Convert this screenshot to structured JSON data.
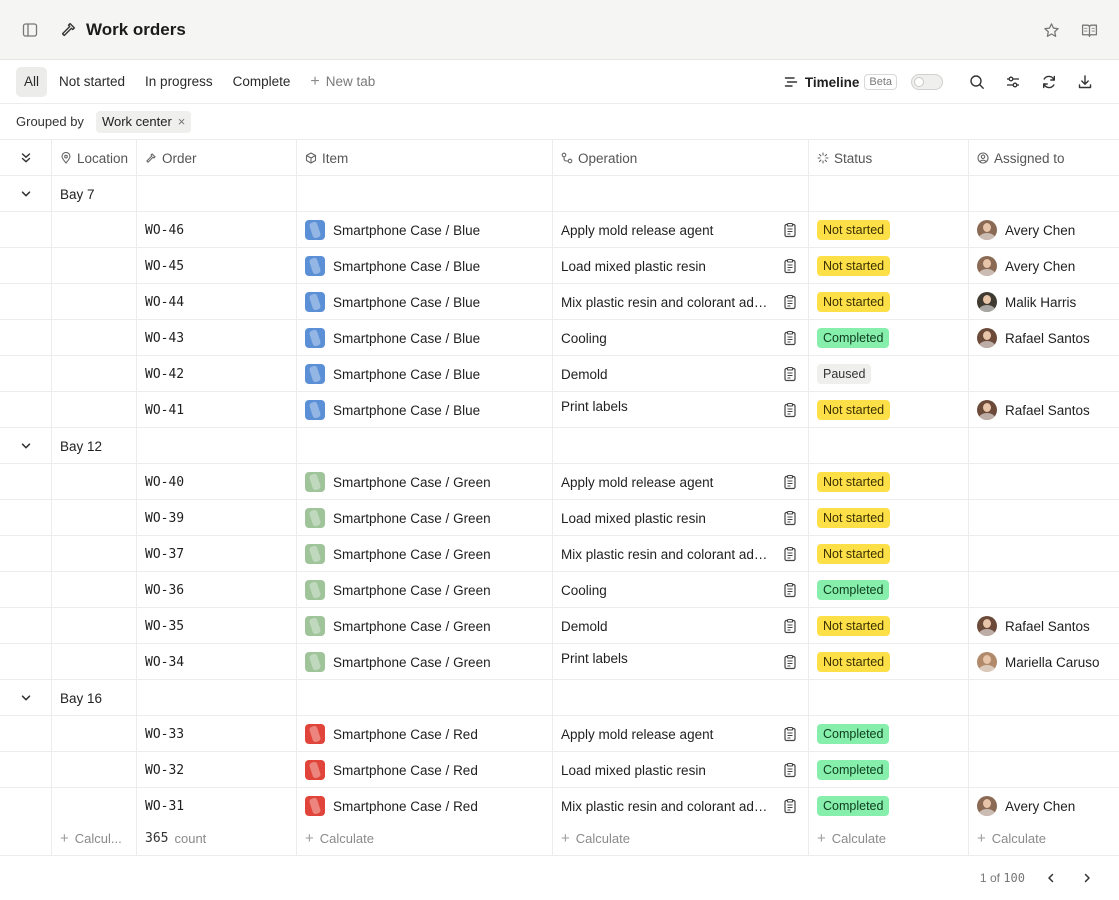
{
  "header": {
    "title": "Work orders"
  },
  "tabs": [
    {
      "label": "All",
      "active": true
    },
    {
      "label": "Not started",
      "active": false
    },
    {
      "label": "In progress",
      "active": false
    },
    {
      "label": "Complete",
      "active": false
    }
  ],
  "new_tab_label": "New tab",
  "toolbar": {
    "timeline_label": "Timeline",
    "beta_label": "Beta",
    "timeline_enabled": false
  },
  "grouping": {
    "label": "Grouped by",
    "chip": "Work center"
  },
  "columns": [
    "Location",
    "Order",
    "Item",
    "Operation",
    "Status",
    "Assigned to"
  ],
  "colors": {
    "not_started": "#fde047",
    "completed": "#86efac",
    "paused": "#efefed",
    "blue_item": "#5b8fd6",
    "green_item": "#9fc49a",
    "red_item": "#e0443a"
  },
  "groups": [
    {
      "name": "Bay 7",
      "rows": [
        {
          "order": "WO-46",
          "item": "Smartphone Case / Blue",
          "item_color": "blue",
          "operation": "Apply mold release agent",
          "status": "Not started",
          "assignee": "Avery Chen"
        },
        {
          "order": "WO-45",
          "item": "Smartphone Case / Blue",
          "item_color": "blue",
          "operation": "Load mixed plastic resin",
          "status": "Not started",
          "assignee": "Avery Chen"
        },
        {
          "order": "WO-44",
          "item": "Smartphone Case / Blue",
          "item_color": "blue",
          "operation": "Mix plastic resin and colorant additives",
          "status": "Not started",
          "assignee": "Malik Harris"
        },
        {
          "order": "WO-43",
          "item": "Smartphone Case / Blue",
          "item_color": "blue",
          "operation": "Cooling",
          "status": "Completed",
          "assignee": "Rafael Santos"
        },
        {
          "order": "WO-42",
          "item": "Smartphone Case / Blue",
          "item_color": "blue",
          "operation": "Demold",
          "status": "Paused",
          "assignee": ""
        },
        {
          "order": "WO-41",
          "item": "Smartphone Case / Blue",
          "item_color": "blue",
          "operation": "Print labels",
          "status": "Not started",
          "assignee": "Rafael Santos"
        }
      ]
    },
    {
      "name": "Bay 12",
      "rows": [
        {
          "order": "WO-40",
          "item": "Smartphone Case / Green",
          "item_color": "green",
          "operation": "Apply mold release agent",
          "status": "Not started",
          "assignee": ""
        },
        {
          "order": "WO-39",
          "item": "Smartphone Case / Green",
          "item_color": "green",
          "operation": "Load mixed plastic resin",
          "status": "Not started",
          "assignee": ""
        },
        {
          "order": "WO-37",
          "item": "Smartphone Case / Green",
          "item_color": "green",
          "operation": "Mix plastic resin and colorant additives",
          "status": "Not started",
          "assignee": ""
        },
        {
          "order": "WO-36",
          "item": "Smartphone Case / Green",
          "item_color": "green",
          "operation": "Cooling",
          "status": "Completed",
          "assignee": ""
        },
        {
          "order": "WO-35",
          "item": "Smartphone Case / Green",
          "item_color": "green",
          "operation": "Demold",
          "status": "Not started",
          "assignee": "Rafael Santos"
        },
        {
          "order": "WO-34",
          "item": "Smartphone Case / Green",
          "item_color": "green",
          "operation": "Print labels",
          "status": "Not started",
          "assignee": "Mariella Caruso"
        }
      ]
    },
    {
      "name": "Bay 16",
      "rows": [
        {
          "order": "WO-33",
          "item": "Smartphone Case / Red",
          "item_color": "red",
          "operation": "Apply mold release agent",
          "status": "Completed",
          "assignee": ""
        },
        {
          "order": "WO-32",
          "item": "Smartphone Case / Red",
          "item_color": "red",
          "operation": "Load mixed plastic resin",
          "status": "Completed",
          "assignee": ""
        },
        {
          "order": "WO-31",
          "item": "Smartphone Case / Red",
          "item_color": "red",
          "operation": "Mix plastic resin and colorant additives",
          "status": "Completed",
          "assignee": "Avery Chen"
        }
      ]
    }
  ],
  "footer": {
    "location_calc": "Calcul...",
    "count_value": "365",
    "count_label": "count",
    "calculate_label": "Calculate"
  },
  "pagination": {
    "current": "1",
    "of_label": "of",
    "total": "100"
  }
}
